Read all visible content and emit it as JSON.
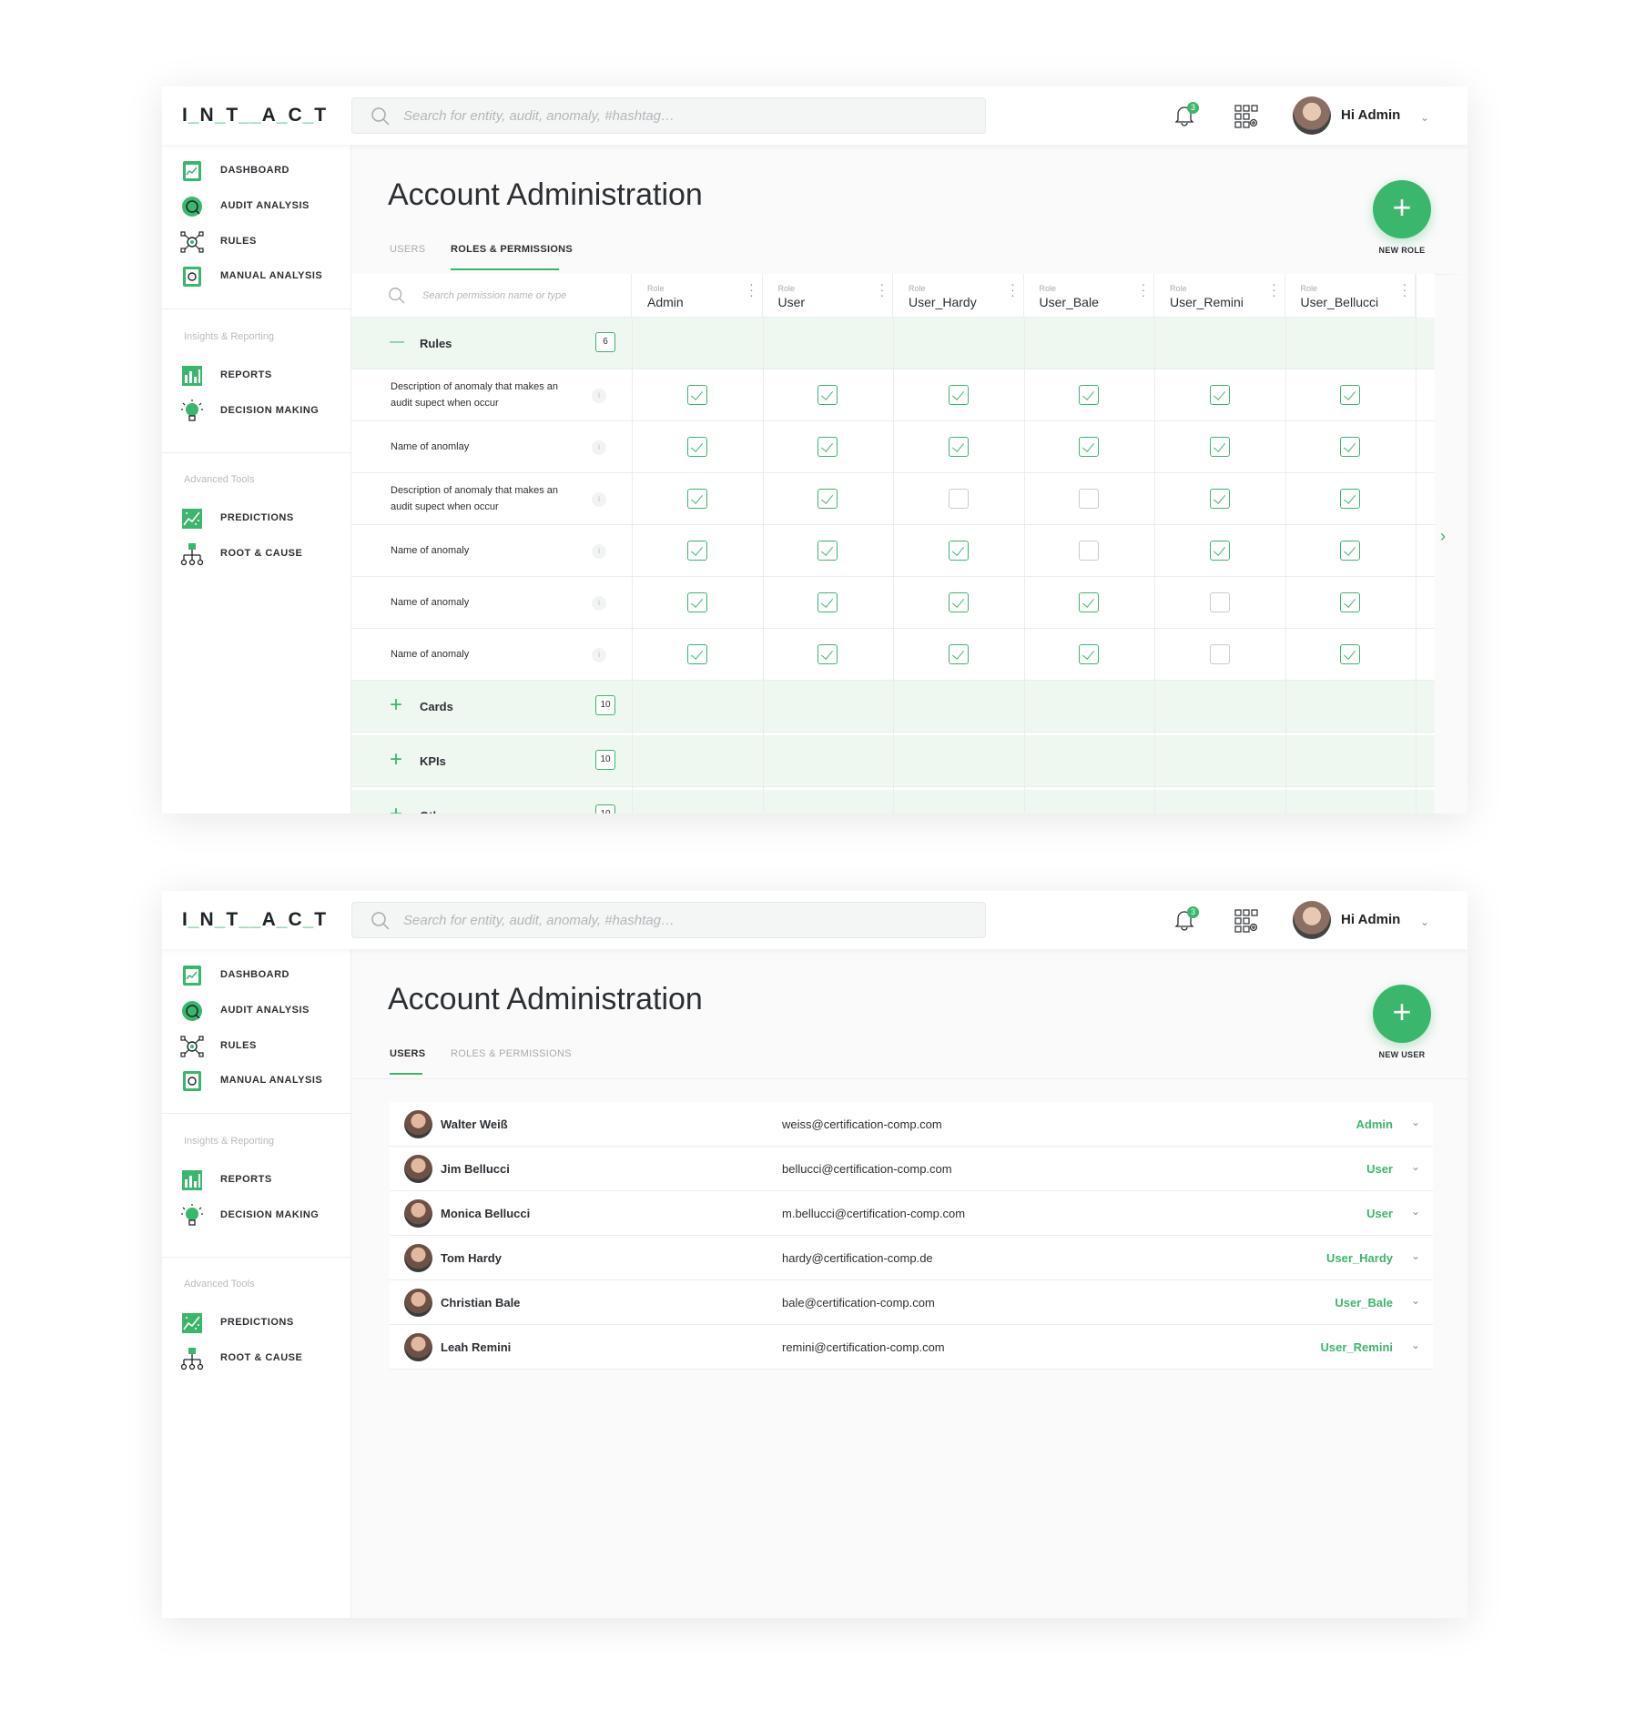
{
  "logo": {
    "p1": "I",
    "s1": "_",
    "p2": "N",
    "s2": "_",
    "p3": "T",
    "s3": "__",
    "p4": "A",
    "s4": "_",
    "p5": "C",
    "s5": "_",
    "p6": "T"
  },
  "header": {
    "search_placeholder": "Search for entity, audit, anomaly, #hashtag…",
    "notification_count": "3",
    "greeting": "Hi Admin"
  },
  "sidebar": {
    "items": [
      {
        "label": "DASHBOARD",
        "icon": "dashboard-icon"
      },
      {
        "label": "AUDIT ANALYSIS",
        "icon": "audit-analysis-icon"
      },
      {
        "label": "RULES",
        "icon": "rules-icon"
      },
      {
        "label": "MANUAL ANALYSIS",
        "icon": "manual-analysis-icon"
      }
    ],
    "section_insights": "Insights & Reporting",
    "insights_items": [
      {
        "label": "REPORTS",
        "icon": "reports-icon"
      },
      {
        "label": "DECISION MAKING",
        "icon": "decision-making-icon"
      }
    ],
    "section_advanced": "Advanced Tools",
    "advanced_items": [
      {
        "label": "PREDICTIONS",
        "icon": "predictions-icon"
      },
      {
        "label": "ROOT & CAUSE",
        "icon": "root-cause-icon"
      }
    ]
  },
  "page": {
    "title": "Account Administration",
    "tab_users": "USERS",
    "tab_roles": "ROLES & PERMISSIONS"
  },
  "roles_screen": {
    "active_tab": "roles",
    "fab_label": "NEW ROLE",
    "permission_search_placeholder": "Search permission name or type",
    "role_prefix": "Role",
    "roles": [
      "Admin",
      "User",
      "User_Hardy",
      "User_Bale",
      "User_Remini",
      "User_Bellucci"
    ],
    "groups": [
      {
        "label": "Rules",
        "count": "6",
        "expanded": true
      },
      {
        "label": "Cards",
        "count": "10",
        "expanded": false
      },
      {
        "label": "KPIs",
        "count": "10",
        "expanded": false
      },
      {
        "label": "Other",
        "count": "10",
        "expanded": false
      }
    ],
    "permissions": [
      {
        "line1": "Description of anomaly that makes an",
        "line2": "audit supect when occur",
        "checks": [
          true,
          true,
          true,
          true,
          true,
          true
        ]
      },
      {
        "line1": "Name of anomlay",
        "line2": "",
        "checks": [
          true,
          true,
          true,
          true,
          true,
          true
        ]
      },
      {
        "line1": "Description of anomaly that makes an",
        "line2": "audit supect when occur",
        "checks": [
          true,
          true,
          false,
          false,
          true,
          true
        ]
      },
      {
        "line1": "Name of anomaly",
        "line2": "",
        "checks": [
          true,
          true,
          true,
          false,
          true,
          true
        ]
      },
      {
        "line1": "Name of anomaly",
        "line2": "",
        "checks": [
          true,
          true,
          true,
          true,
          false,
          true
        ]
      },
      {
        "line1": "Name of anomaly",
        "line2": "",
        "checks": [
          true,
          true,
          true,
          true,
          false,
          true
        ]
      }
    ],
    "info_glyph": "i"
  },
  "users_screen": {
    "active_tab": "users",
    "fab_label": "NEW USER",
    "users": [
      {
        "name": "Walter Weiß",
        "email": "weiss@certification-comp.com",
        "role": "Admin"
      },
      {
        "name": "Jim Bellucci",
        "email": "bellucci@certification-comp.com",
        "role": "User"
      },
      {
        "name": "Monica Bellucci",
        "email": "m.bellucci@certification-comp.com",
        "role": "User"
      },
      {
        "name": "Tom Hardy",
        "email": "hardy@certification-comp.de",
        "role": "User_Hardy"
      },
      {
        "name": "Christian Bale",
        "email": "bale@certification-comp.com",
        "role": "User_Bale"
      },
      {
        "name": "Leah Remini",
        "email": "remini@certification-comp.com",
        "role": "User_Remini"
      }
    ]
  },
  "colors": {
    "accent": "#3bb66d",
    "group_bg": "#eef8f1"
  }
}
